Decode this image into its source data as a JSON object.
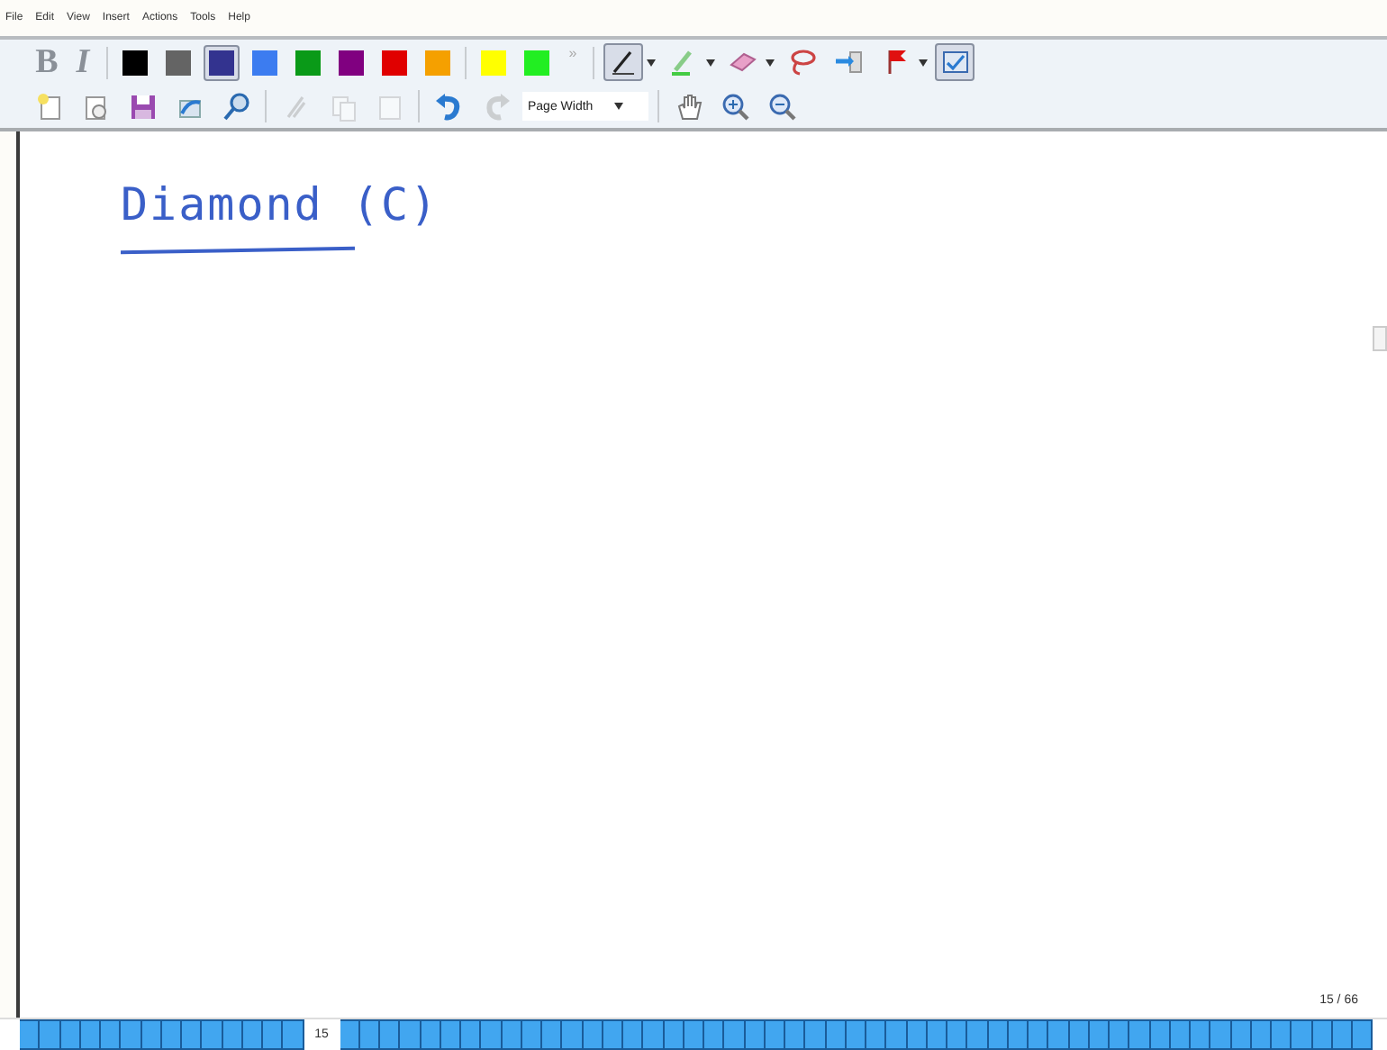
{
  "menu": [
    {
      "label": "File"
    },
    {
      "label": "Edit"
    },
    {
      "label": "View"
    },
    {
      "label": "Insert"
    },
    {
      "label": "Actions"
    },
    {
      "label": "Tools"
    },
    {
      "label": "Help"
    }
  ],
  "pen_toolbar": [
    {
      "kind": "bold",
      "label": "B",
      "disabled": true
    },
    {
      "kind": "italic",
      "label": "I",
      "disabled": true
    },
    {
      "kind": "sep"
    },
    {
      "kind": "swatch",
      "color": "#000000",
      "selected": false
    },
    {
      "kind": "swatch",
      "color": "#646464",
      "selected": false
    },
    {
      "kind": "swatch",
      "color": "#33338f",
      "selected": true
    },
    {
      "kind": "swatch",
      "color": "#3c7cf0",
      "selected": false
    },
    {
      "kind": "swatch",
      "color": "#0a9a18",
      "selected": false
    },
    {
      "kind": "swatch",
      "color": "#800080",
      "selected": false
    },
    {
      "kind": "swatch",
      "color": "#e00000",
      "selected": false
    },
    {
      "kind": "swatch",
      "color": "#f5a000",
      "selected": false
    },
    {
      "kind": "sep"
    },
    {
      "kind": "swatch",
      "color": "#ffff00",
      "selected": false
    },
    {
      "kind": "swatch",
      "color": "#22ee22",
      "selected": false
    },
    {
      "kind": "more",
      "label": "»"
    },
    {
      "kind": "sep"
    },
    {
      "kind": "pen",
      "selected": true,
      "dropdown": true
    },
    {
      "kind": "highlighter",
      "selected": false,
      "dropdown": true
    },
    {
      "kind": "eraser",
      "selected": false,
      "dropdown": true
    },
    {
      "kind": "lasso",
      "selected": false
    },
    {
      "kind": "insert-space",
      "selected": false
    },
    {
      "kind": "flag",
      "selected": false,
      "dropdown": true
    },
    {
      "kind": "view",
      "selected": true
    }
  ],
  "standard_toolbar": [
    {
      "kind": "new",
      "disabled": false
    },
    {
      "kind": "open",
      "disabled": false
    },
    {
      "kind": "save",
      "disabled": false
    },
    {
      "kind": "send",
      "disabled": false
    },
    {
      "kind": "find",
      "disabled": false
    },
    {
      "kind": "sep"
    },
    {
      "kind": "cut",
      "disabled": true
    },
    {
      "kind": "copy",
      "disabled": true
    },
    {
      "kind": "paste",
      "disabled": true
    },
    {
      "kind": "sep"
    },
    {
      "kind": "undo",
      "disabled": false
    },
    {
      "kind": "redo",
      "disabled": true
    },
    {
      "kind": "zoom-select",
      "value": "Page Width"
    },
    {
      "kind": "sep"
    },
    {
      "kind": "hand",
      "disabled": false
    },
    {
      "kind": "zoom-in",
      "disabled": false
    },
    {
      "kind": "zoom-out",
      "disabled": false
    }
  ],
  "page": {
    "ink_text": "Diamond (C)",
    "page_number": "15 / 66"
  },
  "page_bar": {
    "current_label": "15",
    "pages": [
      {
        "selected": false
      },
      {
        "selected": false
      },
      {
        "selected": false
      },
      {
        "selected": false
      },
      {
        "selected": false
      },
      {
        "selected": false
      },
      {
        "selected": false
      },
      {
        "selected": false
      },
      {
        "selected": false
      },
      {
        "selected": false
      },
      {
        "selected": false
      },
      {
        "selected": false
      },
      {
        "selected": false
      },
      {
        "selected": false
      },
      {
        "selected": true
      },
      {
        "selected": false
      },
      {
        "selected": false
      },
      {
        "selected": false
      },
      {
        "selected": false
      },
      {
        "selected": false
      },
      {
        "selected": false
      },
      {
        "selected": false
      },
      {
        "selected": false
      },
      {
        "selected": false
      },
      {
        "selected": false
      },
      {
        "selected": false
      },
      {
        "selected": false
      },
      {
        "selected": false
      },
      {
        "selected": false
      },
      {
        "selected": false
      },
      {
        "selected": false
      },
      {
        "selected": false
      },
      {
        "selected": false
      },
      {
        "selected": false
      },
      {
        "selected": false
      },
      {
        "selected": false
      },
      {
        "selected": false
      },
      {
        "selected": false
      },
      {
        "selected": false
      },
      {
        "selected": false
      },
      {
        "selected": false
      },
      {
        "selected": false
      },
      {
        "selected": false
      },
      {
        "selected": false
      },
      {
        "selected": false
      },
      {
        "selected": false
      },
      {
        "selected": false
      },
      {
        "selected": false
      },
      {
        "selected": false
      },
      {
        "selected": false
      },
      {
        "selected": false
      },
      {
        "selected": false
      },
      {
        "selected": false
      },
      {
        "selected": false
      },
      {
        "selected": false
      },
      {
        "selected": false
      },
      {
        "selected": false
      },
      {
        "selected": false
      },
      {
        "selected": false
      },
      {
        "selected": false
      },
      {
        "selected": false
      },
      {
        "selected": false
      },
      {
        "selected": false
      },
      {
        "selected": false
      },
      {
        "selected": false
      },
      {
        "selected": false
      }
    ]
  }
}
